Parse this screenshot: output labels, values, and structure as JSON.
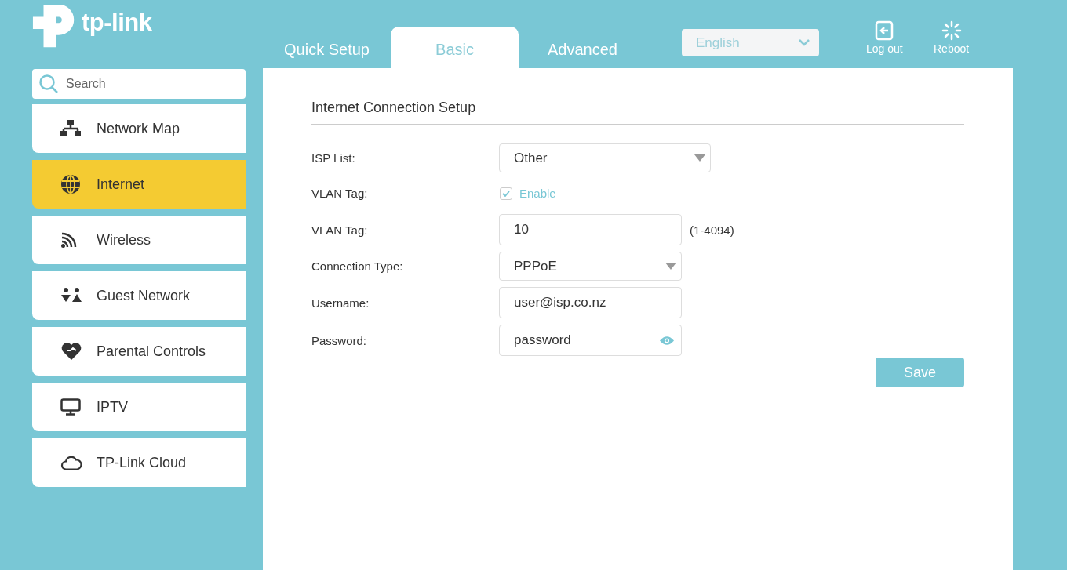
{
  "logo": {
    "text": "tp-link"
  },
  "tabs": [
    {
      "label": "Quick Setup",
      "selected": false
    },
    {
      "label": "Basic",
      "selected": true
    },
    {
      "label": "Advanced",
      "selected": false
    }
  ],
  "language": {
    "value": "English"
  },
  "actions": [
    {
      "label": "Log out",
      "kind": "logout"
    },
    {
      "label": "Reboot",
      "kind": "reboot"
    }
  ],
  "search": {
    "placeholder": "Search"
  },
  "sidebar": {
    "items": [
      {
        "label": "Network Map",
        "kind": "network",
        "selected": false
      },
      {
        "label": "Internet",
        "kind": "globe",
        "selected": true
      },
      {
        "label": "Wireless",
        "kind": "wifi",
        "selected": false
      },
      {
        "label": "Guest Network",
        "kind": "guest",
        "selected": false
      },
      {
        "label": "Parental Controls",
        "kind": "heart",
        "selected": false
      },
      {
        "label": "IPTV",
        "kind": "monitor",
        "selected": false
      },
      {
        "label": "TP-Link Cloud",
        "kind": "cloud",
        "selected": false
      }
    ]
  },
  "section": {
    "title": "Internet Connection Setup"
  },
  "form": [
    {
      "label": "ISP List:",
      "kind": "select",
      "value": "Other"
    },
    {
      "label": "VLAN Tag:",
      "kind": "checkbox",
      "value": "Enable",
      "checked": true
    },
    {
      "label": "VLAN Tag:",
      "kind": "text",
      "value": "10",
      "hint": "(1-4094)"
    },
    {
      "label": "Connection Type:",
      "kind": "select",
      "value": "PPPoE"
    },
    {
      "label": "Username:",
      "kind": "text",
      "value": "user@isp.co.nz"
    },
    {
      "label": "Password:",
      "kind": "password",
      "value": "password"
    }
  ],
  "save": {
    "label": "Save"
  }
}
